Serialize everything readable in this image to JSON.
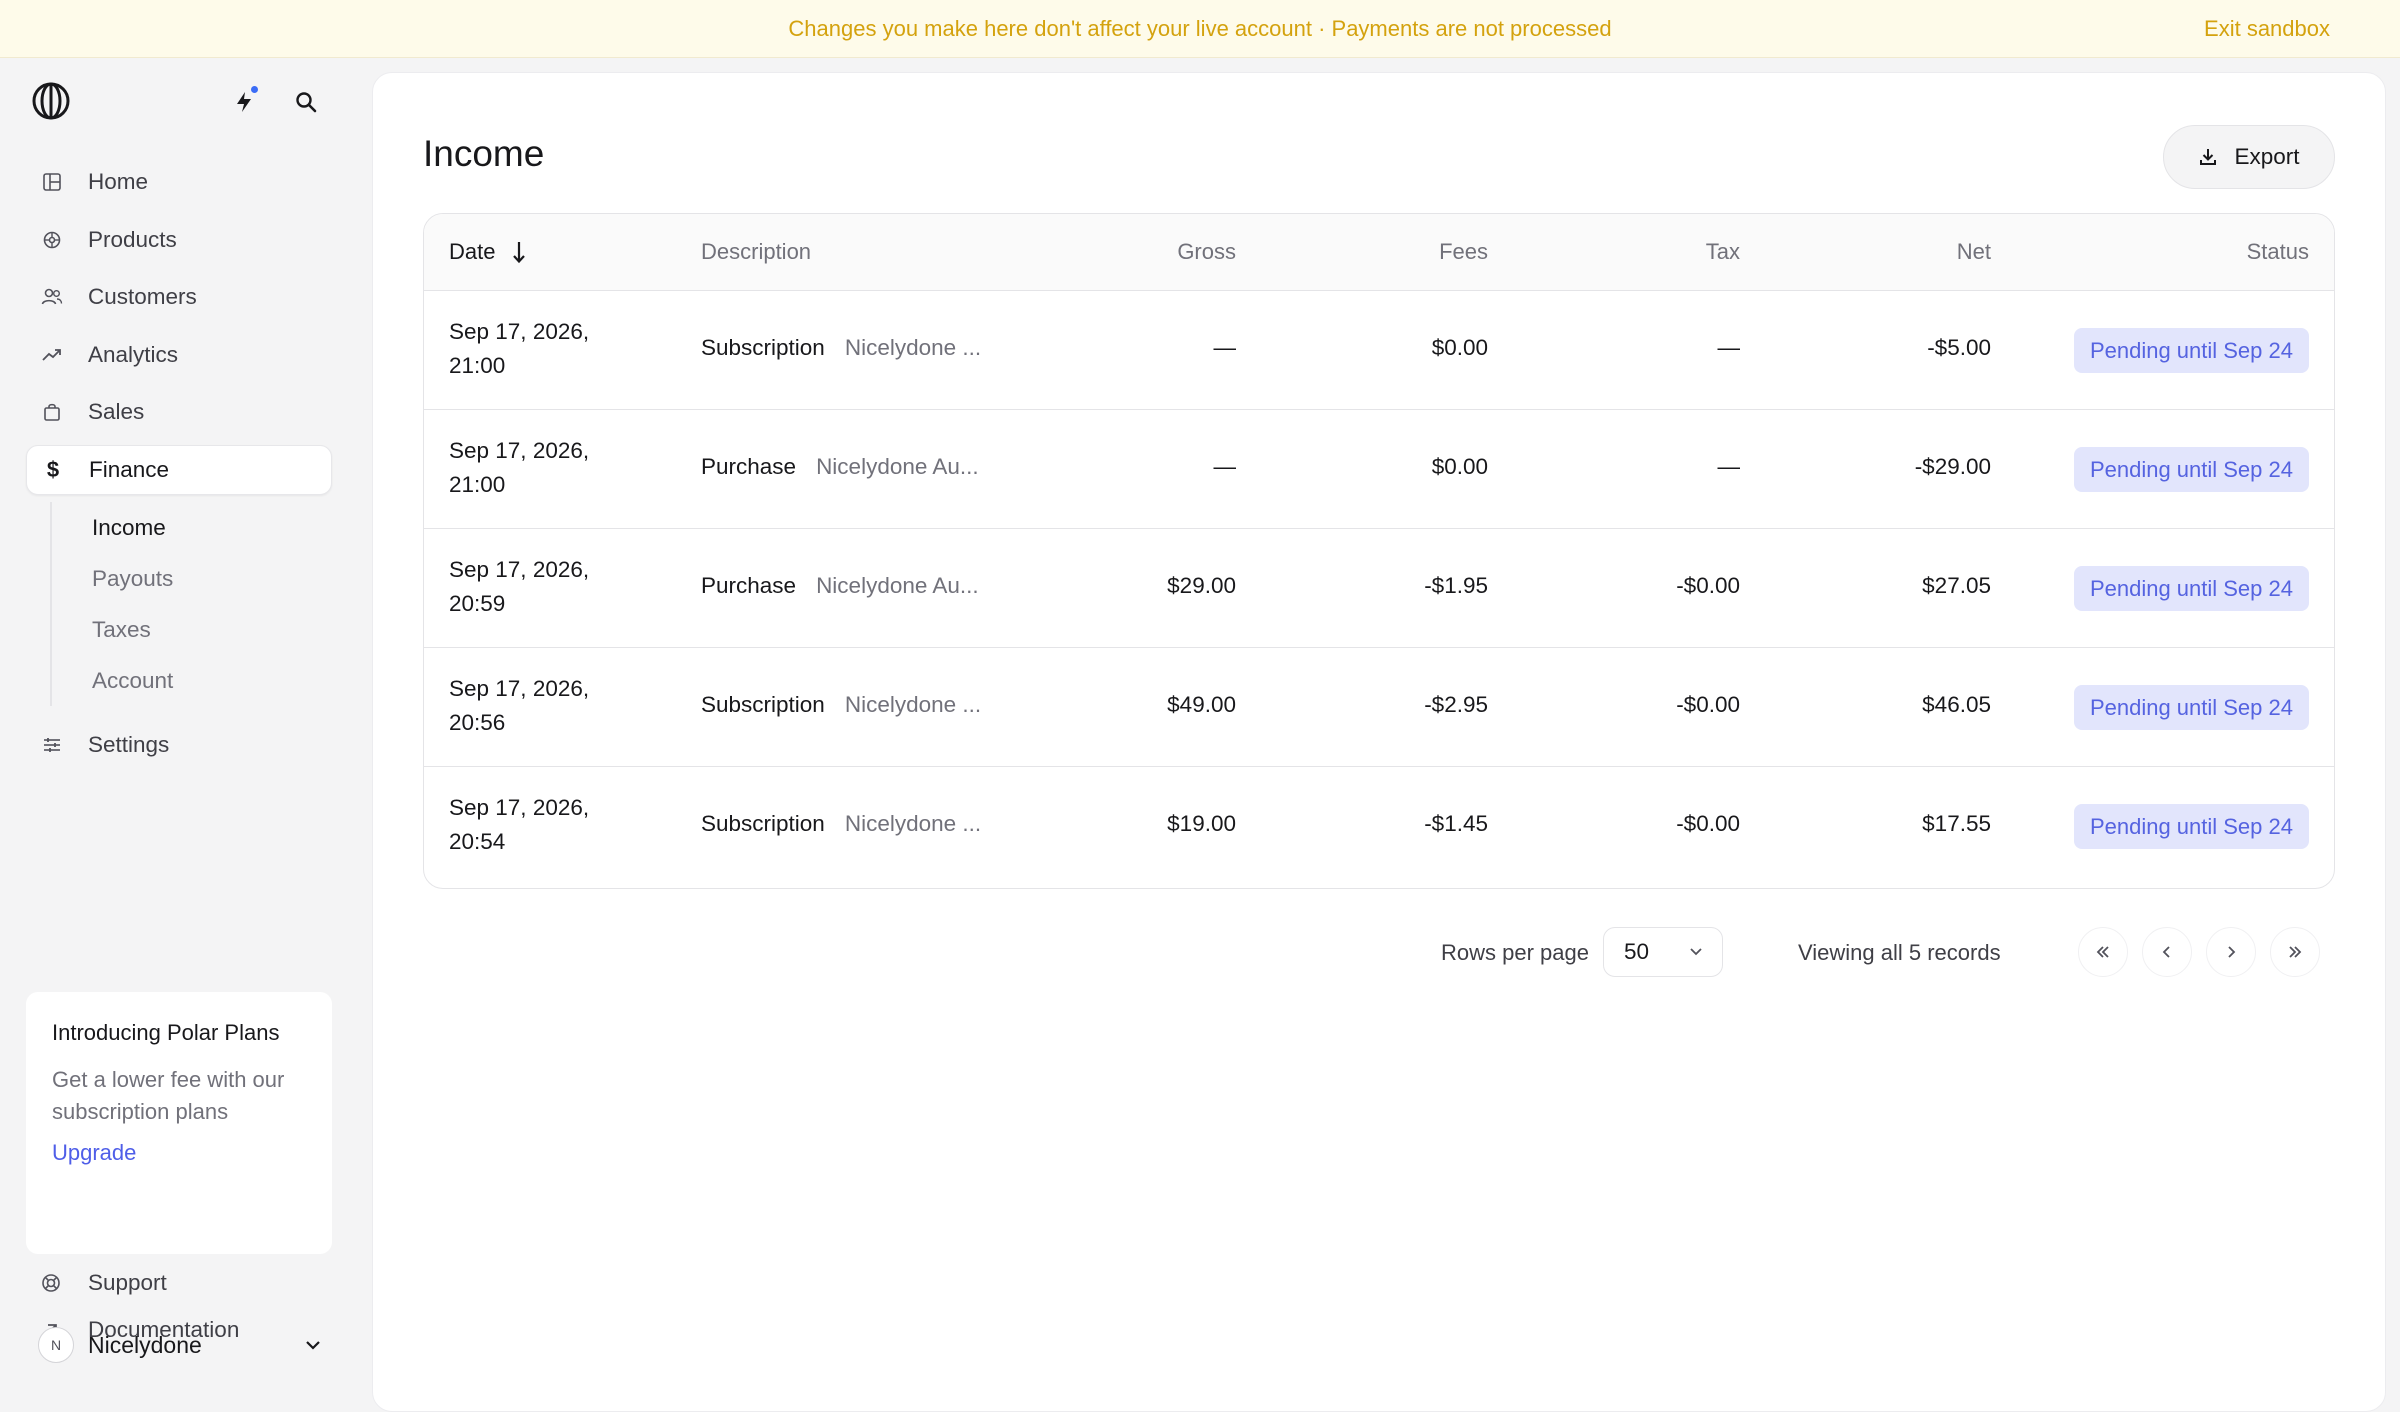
{
  "banner": {
    "message": "Changes you make here don't affect your live account · Payments are not processed",
    "exit_label": "Exit sandbox"
  },
  "sidebar": {
    "items": [
      {
        "label": "Home",
        "icon": "home-icon"
      },
      {
        "label": "Products",
        "icon": "products-icon"
      },
      {
        "label": "Customers",
        "icon": "customers-icon"
      },
      {
        "label": "Analytics",
        "icon": "analytics-icon"
      },
      {
        "label": "Sales",
        "icon": "sales-icon"
      },
      {
        "label": "Finance",
        "icon": "dollar-icon",
        "active": true
      }
    ],
    "finance_sub": [
      {
        "label": "Income",
        "active": true
      },
      {
        "label": "Payouts"
      },
      {
        "label": "Taxes"
      },
      {
        "label": "Account"
      }
    ],
    "settings": {
      "label": "Settings",
      "icon": "settings-icon"
    },
    "promo": {
      "title": "Introducing Polar Plans",
      "description": "Get a lower fee with our subscription plans",
      "link": "Upgrade"
    },
    "support": "Support",
    "documentation": "Documentation",
    "account": {
      "initial": "N",
      "name": "Nicelydone"
    }
  },
  "main": {
    "title": "Income",
    "export_label": "Export",
    "columns": {
      "date": "Date",
      "description": "Description",
      "gross": "Gross",
      "fees": "Fees",
      "tax": "Tax",
      "net": "Net",
      "status": "Status"
    },
    "rows": [
      {
        "date1": "Sep 17, 2026,",
        "date2": "21:00",
        "kind": "Subscription",
        "name": "Nicelydone ...",
        "gross": "—",
        "fees": "$0.00",
        "tax": "—",
        "net": "-$5.00",
        "status": "Pending until Sep 24"
      },
      {
        "date1": "Sep 17, 2026,",
        "date2": "21:00",
        "kind": "Purchase",
        "name": "Nicelydone Au...",
        "gross": "—",
        "fees": "$0.00",
        "tax": "—",
        "net": "-$29.00",
        "status": "Pending until Sep 24"
      },
      {
        "date1": "Sep 17, 2026,",
        "date2": "20:59",
        "kind": "Purchase",
        "name": "Nicelydone Au...",
        "gross": "$29.00",
        "fees": "-$1.95",
        "tax": "-$0.00",
        "net": "$27.05",
        "status": "Pending until Sep 24"
      },
      {
        "date1": "Sep 17, 2026,",
        "date2": "20:56",
        "kind": "Subscription",
        "name": "Nicelydone ...",
        "gross": "$49.00",
        "fees": "-$2.95",
        "tax": "-$0.00",
        "net": "$46.05",
        "status": "Pending until Sep 24"
      },
      {
        "date1": "Sep 17, 2026,",
        "date2": "20:54",
        "kind": "Subscription",
        "name": "Nicelydone ...",
        "gross": "$19.00",
        "fees": "-$1.45",
        "tax": "-$0.00",
        "net": "$17.55",
        "status": "Pending until Sep 24"
      }
    ],
    "pagination": {
      "rows_per_page_label": "Rows per page",
      "rows_per_page_value": "50",
      "viewing": "Viewing all 5 records"
    }
  },
  "colors": {
    "banner_bg": "#fefbea",
    "banner_text": "#d4a20e",
    "badge_bg": "#e2e5fc",
    "badge_text": "#5563e0",
    "link": "#4f5ee8"
  }
}
